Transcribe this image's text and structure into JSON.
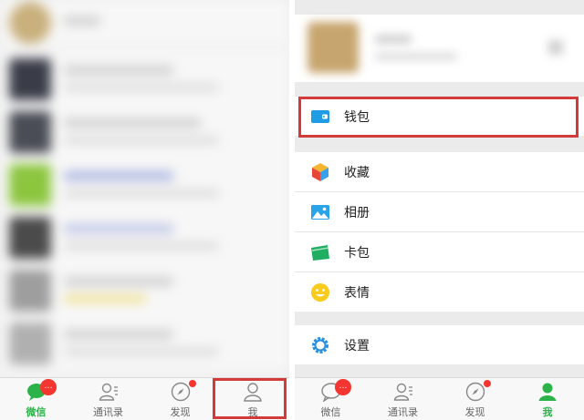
{
  "left_screen": {
    "tabs": [
      {
        "label": "微信",
        "icon": "chat-bubble-icon",
        "badge": "…",
        "active": true
      },
      {
        "label": "通讯录",
        "icon": "contacts-icon",
        "active": false
      },
      {
        "label": "发现",
        "icon": "compass-icon",
        "dot": true,
        "active": false
      },
      {
        "label": "我",
        "icon": "person-icon",
        "active": false,
        "highlighted": true
      }
    ]
  },
  "right_screen": {
    "menu_wallet": [
      {
        "label": "钱包",
        "icon": "wallet-icon",
        "highlighted": true
      }
    ],
    "menu_main": [
      {
        "label": "收藏",
        "icon": "favorites-cube-icon"
      },
      {
        "label": "相册",
        "icon": "album-icon"
      },
      {
        "label": "卡包",
        "icon": "card-pack-icon"
      },
      {
        "label": "表情",
        "icon": "emoji-icon"
      }
    ],
    "menu_settings": [
      {
        "label": "设置",
        "icon": "settings-gear-icon"
      }
    ],
    "tabs": [
      {
        "label": "微信",
        "icon": "chat-bubble-icon",
        "badge": "…",
        "active": false
      },
      {
        "label": "通讯录",
        "icon": "contacts-icon",
        "active": false
      },
      {
        "label": "发现",
        "icon": "compass-icon",
        "dot": true,
        "active": false
      },
      {
        "label": "我",
        "icon": "person-icon",
        "active": true
      }
    ]
  },
  "colors": {
    "accent_green": "#2bb34a",
    "badge_red": "#f43530",
    "highlight_red": "#d33b3b",
    "wallet_blue": "#1f9ce6"
  }
}
